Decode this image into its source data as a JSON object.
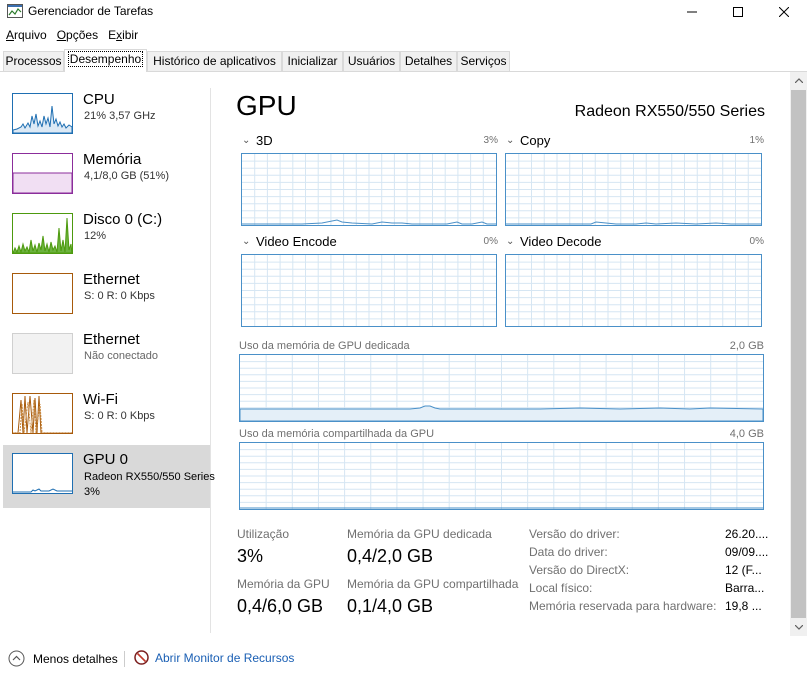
{
  "window": {
    "title": "Gerenciador de Tarefas"
  },
  "menu": {
    "items": [
      {
        "label": "Arquivo",
        "mnemonic_index": 0
      },
      {
        "label": "Opções",
        "mnemonic_index": 0
      },
      {
        "label": "Exibir",
        "mnemonic_index": 1
      }
    ]
  },
  "tabs": [
    {
      "label": "Processos"
    },
    {
      "label": "Desempenho",
      "active": true
    },
    {
      "label": "Histórico de aplicativos"
    },
    {
      "label": "Inicializar"
    },
    {
      "label": "Usuários"
    },
    {
      "label": "Detalhes"
    },
    {
      "label": "Serviços"
    }
  ],
  "sidebar": {
    "items": [
      {
        "name": "CPU",
        "line1": "21%  3,57 GHz",
        "line2": "",
        "color": "#1f6fb2"
      },
      {
        "name": "Memória",
        "line1": "4,1/8,0 GB (51%)",
        "line2": "",
        "color": "#8b2d9b"
      },
      {
        "name": "Disco 0 (C:)",
        "line1": "12%",
        "line2": "",
        "color": "#4d9a0e"
      },
      {
        "name": "Ethernet",
        "line1": "S: 0  R: 0 Kbps",
        "line2": "",
        "color": "#a75a0b"
      },
      {
        "name": "Ethernet",
        "line1": "Não conectado",
        "line2": "",
        "color": "#c8c8c8"
      },
      {
        "name": "Wi-Fi",
        "line1": "S: 0  R: 0 Kbps",
        "line2": "",
        "color": "#a75a0b"
      },
      {
        "name": "GPU 0",
        "line1": "Radeon RX550/550 Series",
        "line2": "3%",
        "color": "#1f6fb2",
        "selected": true
      }
    ]
  },
  "main": {
    "title": "GPU",
    "model": "Radeon RX550/550 Series",
    "engines": [
      {
        "label": "3D",
        "pct": "3%"
      },
      {
        "label": "Copy",
        "pct": "1%"
      },
      {
        "label": "Video Encode",
        "pct": "0%"
      },
      {
        "label": "Video Decode",
        "pct": "0%"
      }
    ],
    "dedicated_memory": {
      "label": "Uso da memória de GPU dedicada",
      "max": "2,0 GB"
    },
    "shared_memory": {
      "label": "Uso da memória compartilhada da GPU",
      "max": "4,0 GB"
    },
    "stats": {
      "utilization_label": "Utilização",
      "utilization_value": "3%",
      "dedicated_label": "Memória da GPU dedicada",
      "dedicated_value": "0,4/2,0 GB",
      "gpu_mem_label": "Memória da GPU",
      "gpu_mem_value": "0,4/6,0 GB",
      "shared_label": "Memória da GPU compartilhada",
      "shared_value": "0,1/4,0 GB"
    },
    "info": [
      {
        "label": "Versão do driver:",
        "value": "26.20...."
      },
      {
        "label": "Data do driver:",
        "value": "09/09...."
      },
      {
        "label": "Versão do DirectX:",
        "value": "12 (F..."
      },
      {
        "label": "Local físico:",
        "value": "Barra..."
      },
      {
        "label": "Memória reservada para hardware:",
        "value": "19,8 ..."
      }
    ]
  },
  "footer": {
    "less_details": "Menos detalhes",
    "resource_monitor": "Abrir Monitor de Recursos"
  },
  "colors": {
    "gpu_accent": "#4a90c8",
    "grid": "#d6e6f3"
  }
}
